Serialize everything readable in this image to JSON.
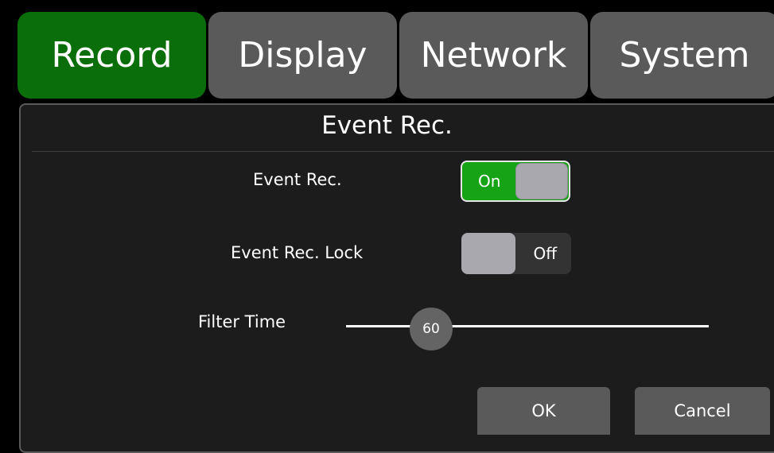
{
  "tabs": [
    {
      "label": "Record",
      "active": true
    },
    {
      "label": "Display",
      "active": false
    },
    {
      "label": "Network",
      "active": false
    },
    {
      "label": "System",
      "active": false
    }
  ],
  "dialog": {
    "title": "Event Rec.",
    "event_rec": {
      "label": "Event Rec.",
      "state": "On"
    },
    "event_rec_lock": {
      "label": "Event Rec. Lock",
      "state": "Off"
    },
    "filter_time": {
      "label": "Filter Time",
      "value": "60"
    },
    "ok_label": "OK",
    "cancel_label": "Cancel"
  },
  "colors": {
    "active_tab": "#0a6e0a",
    "inactive_tab": "#5a5a5a",
    "toggle_on": "#16a316",
    "panel_bg": "#1c1c1c"
  }
}
